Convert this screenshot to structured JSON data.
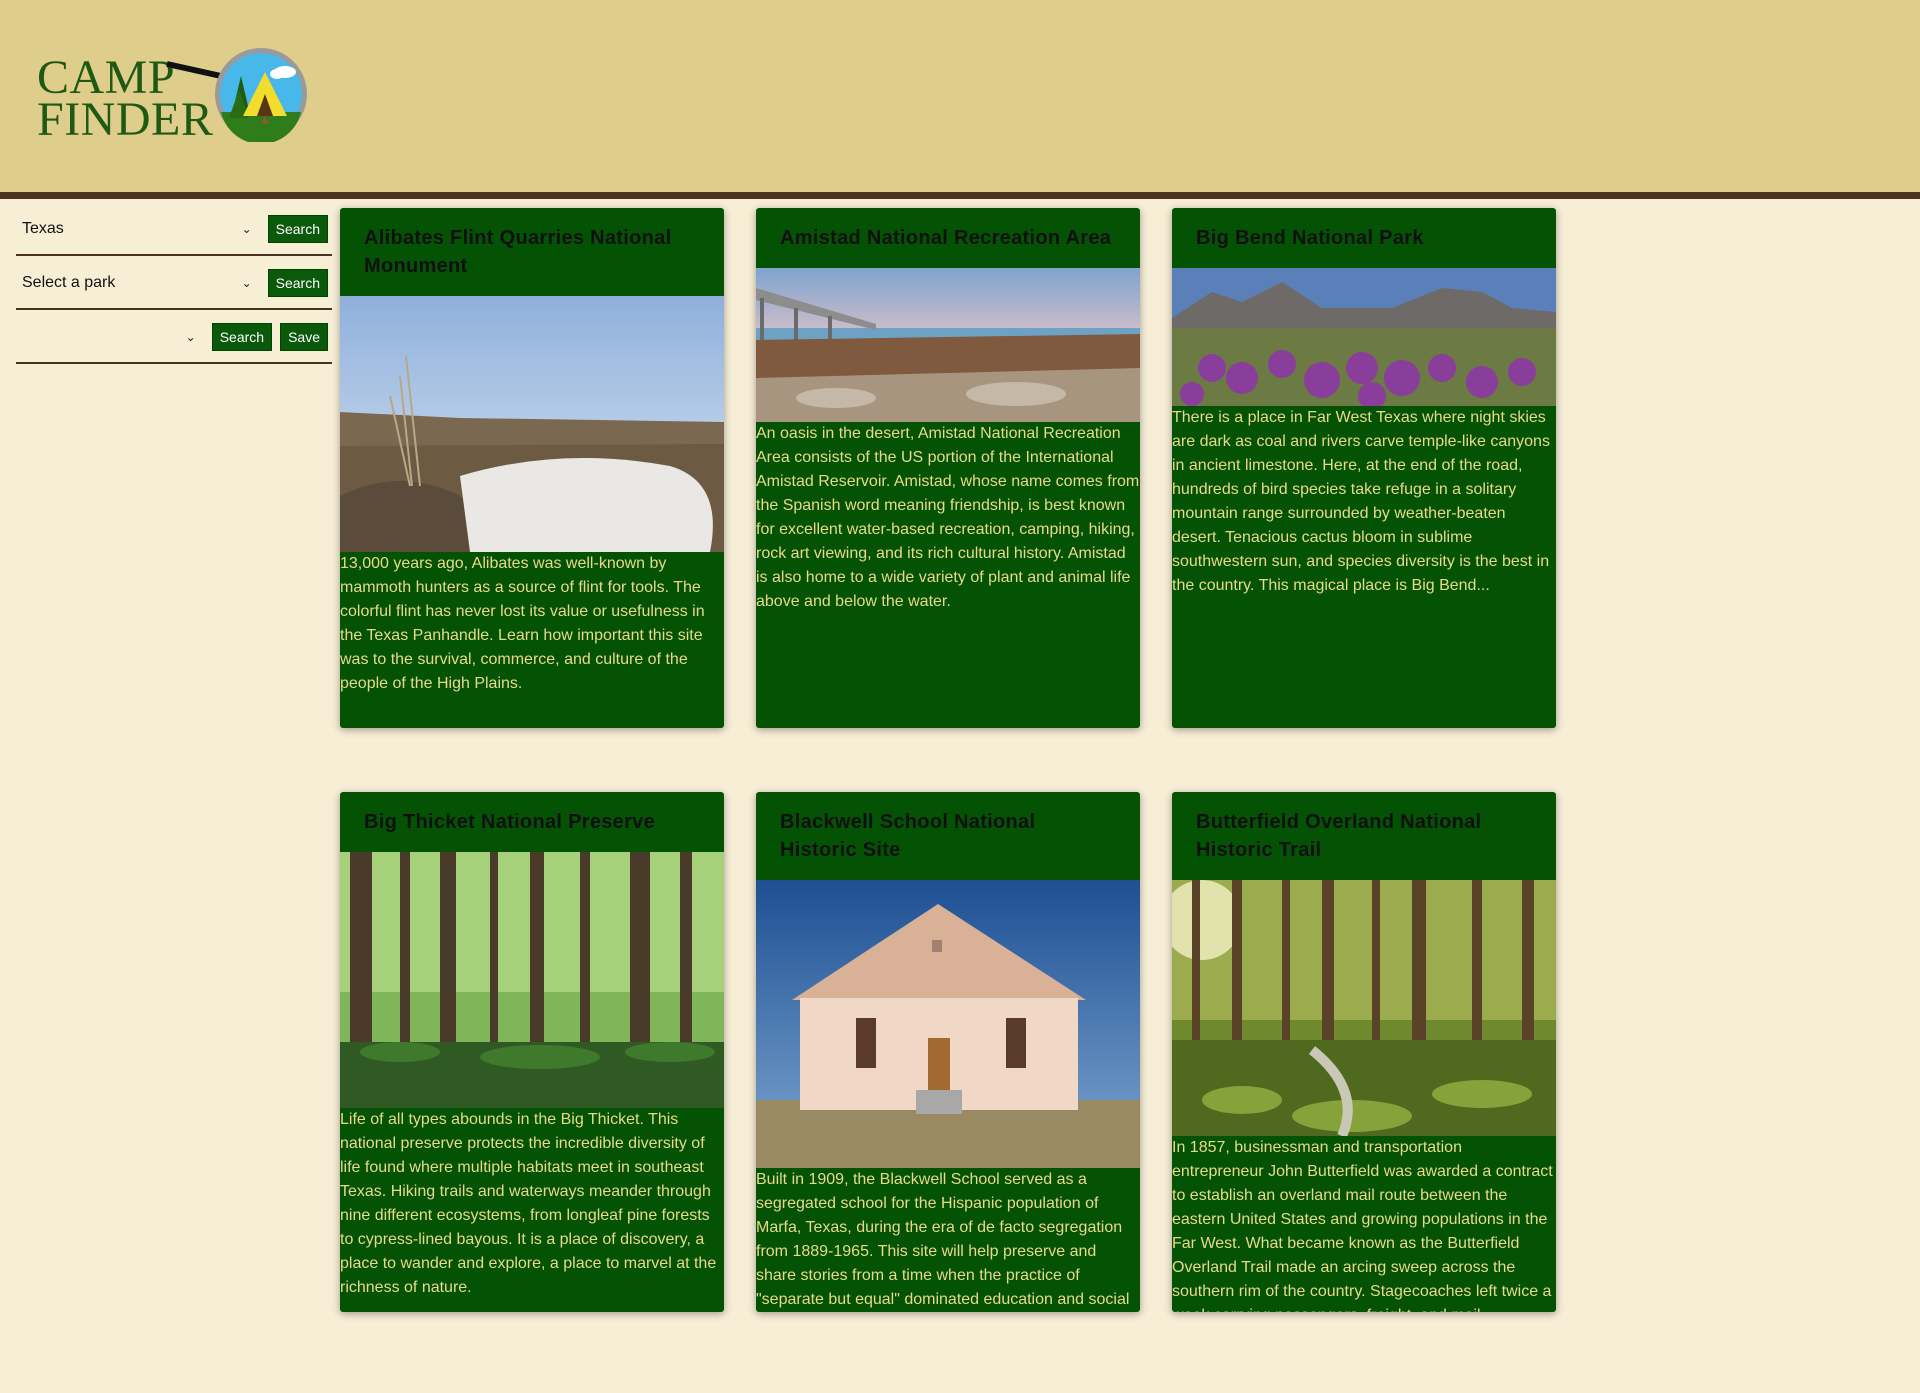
{
  "brand": {
    "line1": "CAMP",
    "line2": "FINDER"
  },
  "filters": {
    "state_select": "Texas",
    "park_select": "Select a park",
    "third_select": "",
    "search_label": "Search",
    "save_label": "Save"
  },
  "parks": [
    {
      "title": "Alibates Flint Quarries National Monument",
      "description": "13,000 years ago, Alibates was well-known by mammoth hunters as a source of flint for tools. The colorful flint has never lost its value or usefulness in the Texas Panhandle. Learn how important this site was to the survival, commerce, and culture of the people of the High Plains."
    },
    {
      "title": "Amistad National Recreation Area",
      "description": "An oasis in the desert, Amistad National Recreation Area consists of the US portion of the International Amistad Reservoir. Amistad, whose name comes from the Spanish word meaning friendship, is best known for excellent water-based recreation, camping, hiking, rock art viewing, and its rich cultural history. Amistad is also home to a wide variety of plant and animal life above and below the water."
    },
    {
      "title": "Big Bend National Park",
      "description": "There is a place in Far West Texas where night skies are dark as coal and rivers carve temple-like canyons in ancient limestone. Here, at the end of the road, hundreds of bird species take refuge in a solitary mountain range surrounded by weather-beaten desert. Tenacious cactus bloom in sublime southwestern sun, and species diversity is the best in the country. This magical place is Big Bend..."
    },
    {
      "title": "Big Thicket National Preserve",
      "description": "Life of all types abounds in the Big Thicket. This national preserve protects the incredible diversity of life found where multiple habitats meet in southeast Texas. Hiking trails and waterways meander through nine different ecosystems, from longleaf pine forests to cypress-lined bayous. It is a place of discovery, a place to wander and explore, a place to marvel at the richness of nature."
    },
    {
      "title": "Blackwell School National Historic Site",
      "description": "Built in 1909, the Blackwell School served as a segregated school for the Hispanic population of Marfa, Texas, during the era of de facto segregation from 1889-1965. This site will help preserve and share stories from a time when the practice of \"separate but equal\" dominated education and social systems in the United States."
    },
    {
      "title": "Butterfield Overland National Historic Trail",
      "description": "In 1857, businessman and transportation entrepreneur John Butterfield was awarded a contract to establish an overland mail route between the eastern United States and growing populations in the Far West. What became known as the Butterfield Overland Trail made an arcing sweep across the southern rim of the country. Stagecoaches left twice a week carrying passengers, freight, and mail."
    }
  ]
}
